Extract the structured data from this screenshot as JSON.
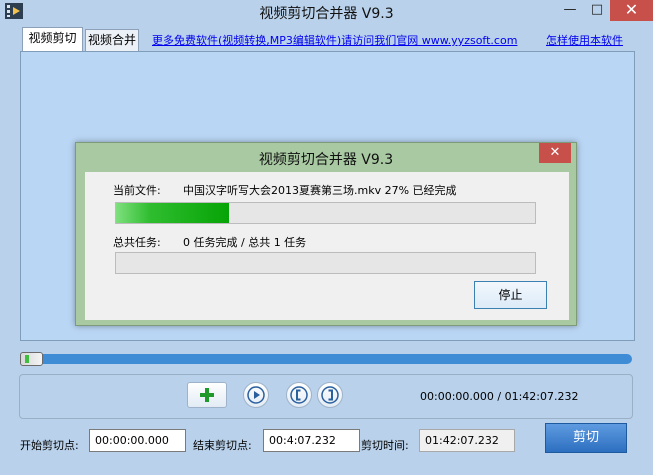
{
  "window": {
    "title": "视频剪切合并器 V9.3",
    "min_glyph": "—",
    "max_glyph": "□",
    "close_glyph": "✕"
  },
  "tabs": [
    {
      "label": "视频剪切",
      "active": true
    },
    {
      "label": "视频合并",
      "active": false
    }
  ],
  "links": {
    "more_software": "更多免费软件(视频转换,MP3编辑软件)请访问我们官网 www.yyzsoft.com",
    "how_to_use": "怎样使用本软件"
  },
  "dialog": {
    "title": "视频剪切合并器 V9.3",
    "close_glyph": "✕",
    "current_file_label": "当前文件:",
    "current_file_value": "中国汉字听写大会2013夏赛第三场.mkv   27% 已经完成",
    "current_progress_percent": 27,
    "total_label": "总共任务:",
    "total_value": "0 任务完成 / 总共 1 任务",
    "total_progress_percent": 0,
    "stop_label": "停止"
  },
  "timeline": {
    "position_fraction": 0.0
  },
  "controls": {
    "icons": [
      "plus-icon",
      "play-icon",
      "mark-in-icon",
      "mark-out-icon"
    ],
    "time_readout": "00:00:00.000 / 01:42:07.232"
  },
  "fields": {
    "start_label": "开始剪切点:",
    "start_value": "00:00:00.000",
    "end_label": "结束剪切点:",
    "end_value": "00:4:07.232",
    "duration_label": "剪切时间:",
    "duration_value": "01:42:07.232",
    "cut_label": "剪切"
  },
  "colors": {
    "accent": "#3f8cd6",
    "progress": "#1fb01f",
    "close": "#c7504b",
    "dialog_frame": "#a8c9a2"
  }
}
